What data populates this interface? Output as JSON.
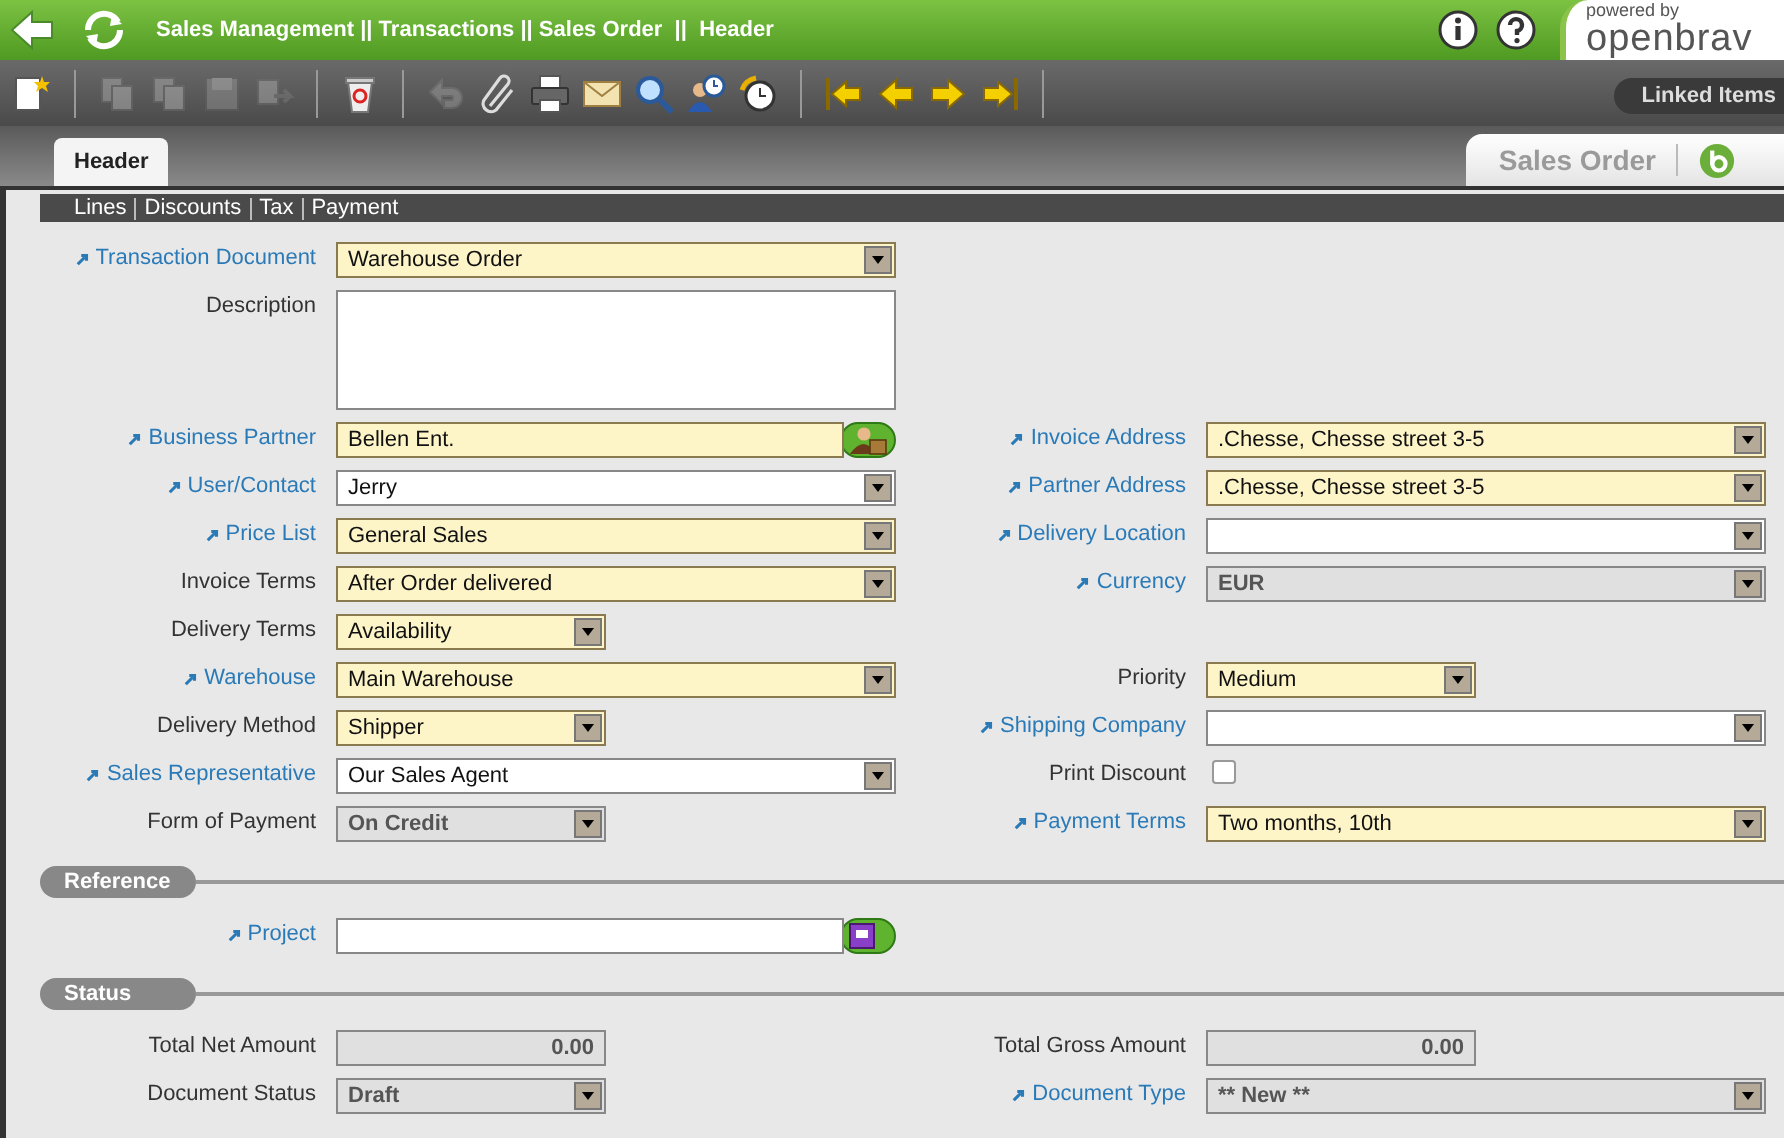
{
  "header": {
    "breadcrumb": "Sales Management || Transactions || Sales Order  ||  Header",
    "logo_tagline": "powered by",
    "logo_word": "openbrav"
  },
  "toolbar": {
    "buttons": [
      {
        "disabled": false
      },
      {
        "disabled": true
      },
      {
        "disabled": true
      },
      {
        "disabled": true
      },
      {
        "disabled": true
      },
      {
        "disabled": false
      },
      {
        "disabled": true
      },
      {
        "disabled": false
      },
      {
        "disabled": false
      },
      {
        "disabled": false
      },
      {
        "disabled": false
      },
      {
        "disabled": false
      },
      {
        "disabled": false
      },
      {
        "disabled": false
      },
      {
        "disabled": false
      },
      {
        "disabled": false
      },
      {
        "disabled": false
      }
    ],
    "linked_items": "Linked Items"
  },
  "tabs": [
    {
      "label": "Header",
      "selected": true
    }
  ],
  "window_title": "Sales Order",
  "subtabs": [
    "Lines",
    "Discounts",
    "Tax",
    "Payment"
  ],
  "form": {
    "rows": [
      {
        "left": {
          "label": "Transaction Document",
          "link": true,
          "kind": "select",
          "value": "Warehouse Order",
          "required": true,
          "readonly": false,
          "short": false
        },
        "right": null
      },
      {
        "left": {
          "label": "Description",
          "link": false,
          "kind": "textarea",
          "required": false
        },
        "right": null
      },
      {
        "left": {
          "label": "Business Partner",
          "link": true,
          "kind": "search",
          "value": "Bellen Ent.",
          "required": true
        },
        "right": {
          "label": "Invoice Address",
          "link": true,
          "kind": "select",
          "value": ".Chesse, Chesse street 3-5",
          "required": true,
          "readonly": false,
          "short": false
        }
      },
      {
        "left": {
          "label": "User/Contact",
          "link": true,
          "kind": "select",
          "value": "Jerry",
          "required": false,
          "readonly": false,
          "short": false
        },
        "right": {
          "label": "Partner Address",
          "link": true,
          "kind": "select",
          "value": ".Chesse, Chesse street 3-5",
          "required": true,
          "readonly": false,
          "short": false
        }
      },
      {
        "left": {
          "label": "Price List",
          "link": true,
          "kind": "select",
          "value": "General Sales",
          "required": true,
          "readonly": false,
          "short": false
        },
        "right": {
          "label": "Delivery Location",
          "link": true,
          "kind": "select",
          "required": false,
          "readonly": false,
          "short": false
        }
      },
      {
        "left": {
          "label": "Invoice Terms",
          "link": false,
          "kind": "select",
          "value": "After Order delivered",
          "required": true,
          "readonly": false,
          "short": false
        },
        "right": {
          "label": "Currency",
          "link": true,
          "kind": "select",
          "value": "EUR",
          "required": false,
          "readonly": true,
          "short": false
        }
      },
      {
        "left": {
          "label": "Delivery Terms",
          "link": false,
          "kind": "select",
          "value": "Availability",
          "required": true,
          "readonly": false,
          "short": true
        },
        "right": null
      },
      {
        "left": {
          "label": "Warehouse",
          "link": true,
          "kind": "select",
          "value": "Main Warehouse",
          "required": true,
          "readonly": false,
          "short": false
        },
        "right": {
          "label": "Priority",
          "link": false,
          "kind": "select",
          "value": "Medium",
          "required": true,
          "readonly": false,
          "short": true
        }
      },
      {
        "left": {
          "label": "Delivery Method",
          "link": false,
          "kind": "select",
          "value": "Shipper",
          "required": true,
          "readonly": false,
          "short": true
        },
        "right": {
          "label": "Shipping Company",
          "link": true,
          "kind": "select",
          "required": false,
          "readonly": false,
          "short": false
        }
      },
      {
        "left": {
          "label": "Sales Representative",
          "link": true,
          "kind": "select",
          "value": "Our Sales Agent",
          "required": false,
          "readonly": false,
          "short": false
        },
        "right": {
          "label": "Print Discount",
          "link": false,
          "kind": "checkbox",
          "checked": false
        }
      },
      {
        "left": {
          "label": "Form of Payment",
          "link": false,
          "kind": "select",
          "value": "On Credit",
          "required": false,
          "readonly": true,
          "short": true
        },
        "right": {
          "label": "Payment Terms",
          "link": true,
          "kind": "select",
          "value": "Two months, 10th",
          "required": true,
          "readonly": false,
          "short": false
        }
      }
    ]
  },
  "sections": [
    {
      "title": "Reference",
      "rows": [
        {
          "left": {
            "label": "Project",
            "link": true,
            "kind": "project",
            "required": false
          },
          "right": null
        }
      ]
    },
    {
      "title": "Status",
      "rows": [
        {
          "left": {
            "label": "Total Net Amount",
            "link": false,
            "kind": "amount",
            "value": "0.00",
            "required": false,
            "readonly": true,
            "short": true
          },
          "right": {
            "label": "Total Gross Amount",
            "link": false,
            "kind": "amount",
            "value": "0.00",
            "required": false,
            "readonly": true,
            "short": true
          }
        },
        {
          "left": {
            "label": "Document Status",
            "link": false,
            "kind": "select",
            "value": "Draft",
            "required": false,
            "readonly": true,
            "short": true
          },
          "right": {
            "label": "Document Type",
            "link": true,
            "kind": "select",
            "value": "** New **",
            "required": false,
            "readonly": true,
            "short": false
          }
        }
      ]
    }
  ]
}
